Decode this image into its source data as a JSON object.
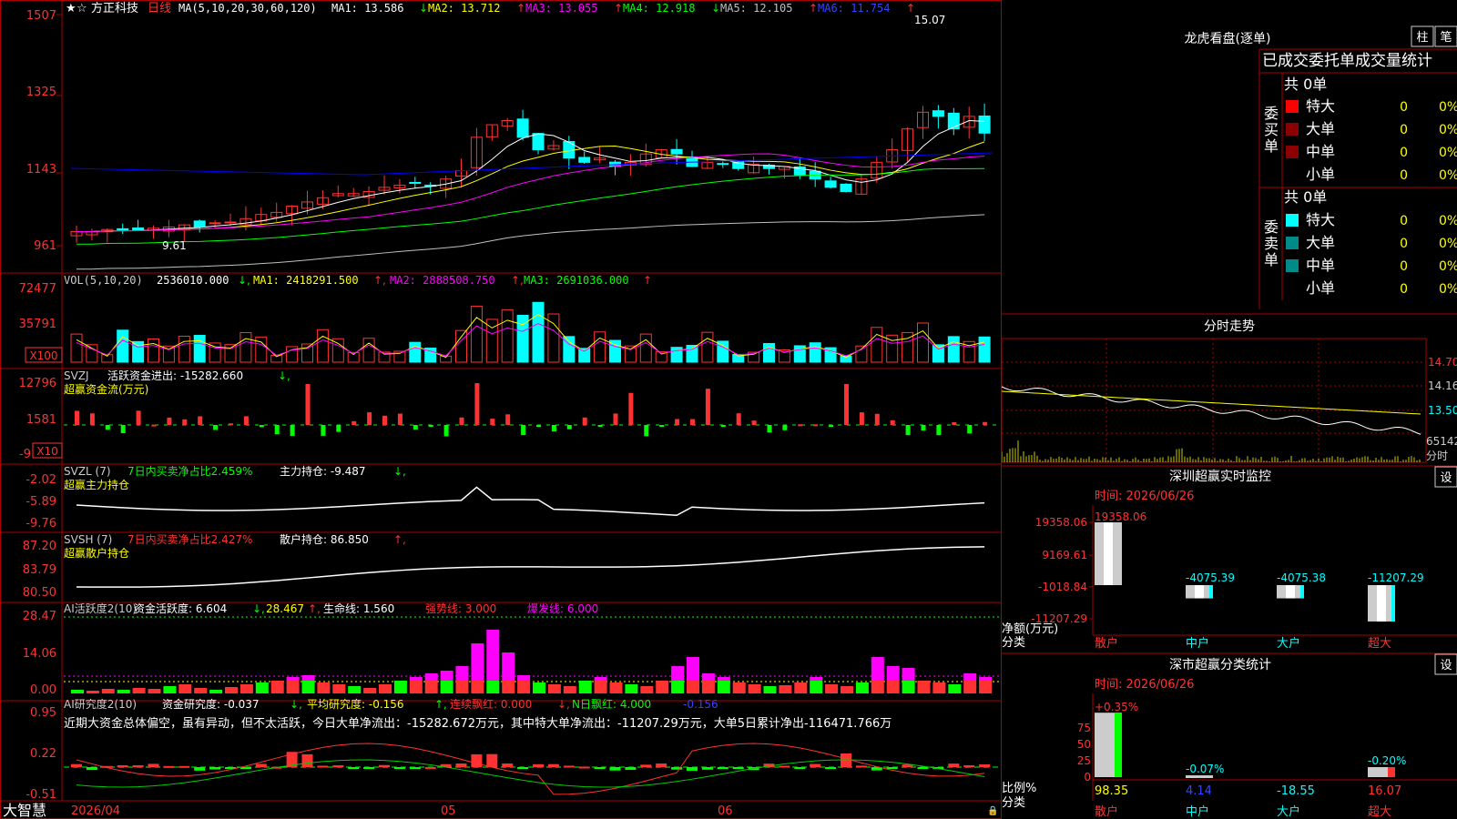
{
  "colors": {
    "up": "#ff3232",
    "down": "#00ffff",
    "ma1": "#ffffff",
    "ma2": "#ffff00",
    "ma3": "#ff00ff",
    "ma4": "#00ff00",
    "ma5": "#c0c0c0",
    "ma6": "#0000ff",
    "grid": "#aa0000"
  },
  "stock": {
    "name": "方正科技",
    "period": "日线"
  },
  "price_panel": {
    "ma_params": "MA(5,10,20,30,60,120)",
    "ma1": "MA1: 13.586",
    "ma2": "MA2: 13.712",
    "ma3": "MA3: 13.055",
    "ma4": "MA4: 12.918",
    "ma5": "MA5: 12.105",
    "ma6": "MA6: 11.754",
    "ma1_arrow": "↓",
    "ma2_arrow": "↑",
    "ma3_arrow": "↑",
    "ma4_arrow": "↓",
    "ma5_arrow": "↑",
    "ma6_arrow": "↑",
    "ticks": [
      "1507",
      "1325",
      "1143",
      "961"
    ],
    "high_label": "15.07",
    "low_label": "9.61"
  },
  "vol_panel": {
    "params": "VOL(5,10,20)",
    "value": "2536010.000",
    "ma1": "MA1: 2418291.500",
    "ma2": "MA2: 2888508.750",
    "ma3": "MA3: 2691036.000",
    "ticks": [
      "72477",
      "35791"
    ],
    "unit": "X100"
  },
  "svzj_panel": {
    "params": "SVZJ",
    "label": "活跃资金进出: -15282.660",
    "subtitle": "超赢资金流(万元)",
    "ticks": [
      "12796",
      "1581",
      "-9"
    ],
    "unit": "X10"
  },
  "svzl_panel": {
    "params": "SVZL (7)",
    "label": "7日内买卖净占比2.459%",
    "hold": "主力持仓: -9.487",
    "subtitle": "超赢主力持仓",
    "ticks": [
      "-2.02",
      "-5.89",
      "-9.76"
    ]
  },
  "svsh_panel": {
    "params": "SVSH (7)",
    "label": "7日内买卖净占比2.427%",
    "hold": "散户持仓: 86.850",
    "subtitle": "超赢散户持仓",
    "ticks": [
      "87.20",
      "83.79",
      "80.50"
    ]
  },
  "ai_active_panel": {
    "params": "AI活跃度2(10)",
    "a": "资金活跃度: 6.604",
    "b": "28.467",
    "c": "生命线: 1.560",
    "d": "强势线: 3.000",
    "e": "爆发线: 6.000",
    "ticks": [
      "28.47",
      "14.06",
      "0.00"
    ]
  },
  "ai_research_panel": {
    "params": "AI研究度2(10)",
    "a": "资金研究度: -0.037",
    "b": "平均研究度: -0.156",
    "c": "连续飘红: 0.000",
    "d": "N日飘红: 4.000",
    "e": "-0.156",
    "desc": "近期大资金总体偏空，虽有异动，但不太活跃，今日大单净流出：-15282.672万元，其中特大单净流出：-11207.29万元，大单5日累计净出-116471.766万",
    "ticks": [
      "0.95",
      "0.22",
      "-0.51"
    ]
  },
  "date_axis": {
    "start": "2026/04",
    "m05": "05",
    "m06": "06"
  },
  "brand": "大智慧",
  "longhu": {
    "title": "龙虎看盘(逐单)",
    "btn1": "柱",
    "btn2": "笔",
    "header": "已成交委托单成交量统计",
    "buy_label": "委买单",
    "sell_label": "委卖单",
    "buy_total": "共 0单",
    "sell_total": "共 0单",
    "buy_rows": [
      {
        "name": "特大",
        "val": "0",
        "pct": "0%"
      },
      {
        "name": "大单",
        "val": "0",
        "pct": "0%"
      },
      {
        "name": "中单",
        "val": "0",
        "pct": "0%"
      },
      {
        "name": "小单",
        "val": "0",
        "pct": "0%"
      }
    ],
    "sell_rows": [
      {
        "name": "特大",
        "val": "0",
        "pct": "0%"
      },
      {
        "name": "大单",
        "val": "0",
        "pct": "0%"
      },
      {
        "name": "中单",
        "val": "0",
        "pct": "0%"
      },
      {
        "name": "小单",
        "val": "0",
        "pct": "0%"
      }
    ]
  },
  "intraday": {
    "title": "分时走势",
    "ticks": [
      "14.70",
      "14.16",
      "13.50"
    ],
    "vol_tick": "65142",
    "unit": "分时"
  },
  "monitor": {
    "title": "深圳超赢实时监控",
    "btn": "设",
    "time": "时间: 2026/06/26",
    "ticks": [
      "19358.06",
      "9169.61",
      "-1018.84",
      "-11207.29"
    ],
    "ylabel": "净额(万元)",
    "xlabel": "分类",
    "cats": [
      "散户",
      "中户",
      "大户",
      "超大"
    ],
    "values": [
      19358.06,
      -4075.39,
      -4075.38,
      -11207.29
    ],
    "value_labels": [
      "19358.06",
      "-4075.39",
      "-4075.38",
      "-11207.29"
    ]
  },
  "classify": {
    "title": "深市超赢分类统计",
    "btn": "设",
    "time": "时间: 2026/06/26",
    "ticks": [
      "75",
      "50",
      "25",
      "0"
    ],
    "ylabel": "比例%",
    "xlabel": "分类",
    "cats": [
      "散户",
      "中户",
      "大户",
      "超大"
    ],
    "top_labels": [
      "+0.35%",
      "-0.07%",
      "",
      "-0.20%"
    ],
    "bottom_labels": [
      "98.35",
      "4.14",
      "-18.55",
      "16.07"
    ],
    "values": [
      98.35,
      4.14,
      -18.55,
      16.07
    ]
  },
  "chart_data": [
    {
      "type": "candlestick",
      "title": "方正科技 日线",
      "series": [
        {
          "name": "MA1",
          "value": 13.586
        },
        {
          "name": "MA2",
          "value": 13.712
        },
        {
          "name": "MA3",
          "value": 13.055
        },
        {
          "name": "MA4",
          "value": 12.918
        },
        {
          "name": "MA5",
          "value": 12.105
        },
        {
          "name": "MA6",
          "value": 11.754
        }
      ],
      "ylim": [
        9.61,
        15.07
      ]
    },
    {
      "type": "bar",
      "title": "VOL(5,10,20)",
      "values": [
        2536010
      ]
    },
    {
      "type": "bar",
      "title": "净额(万元)",
      "categories": [
        "散户",
        "中户",
        "大户",
        "超大"
      ],
      "values": [
        19358.06,
        -4075.39,
        -4075.38,
        -11207.29
      ]
    },
    {
      "type": "bar",
      "title": "比例%",
      "categories": [
        "散户",
        "中户",
        "大户",
        "超大"
      ],
      "values": [
        98.35,
        4.14,
        -18.55,
        16.07
      ]
    }
  ]
}
